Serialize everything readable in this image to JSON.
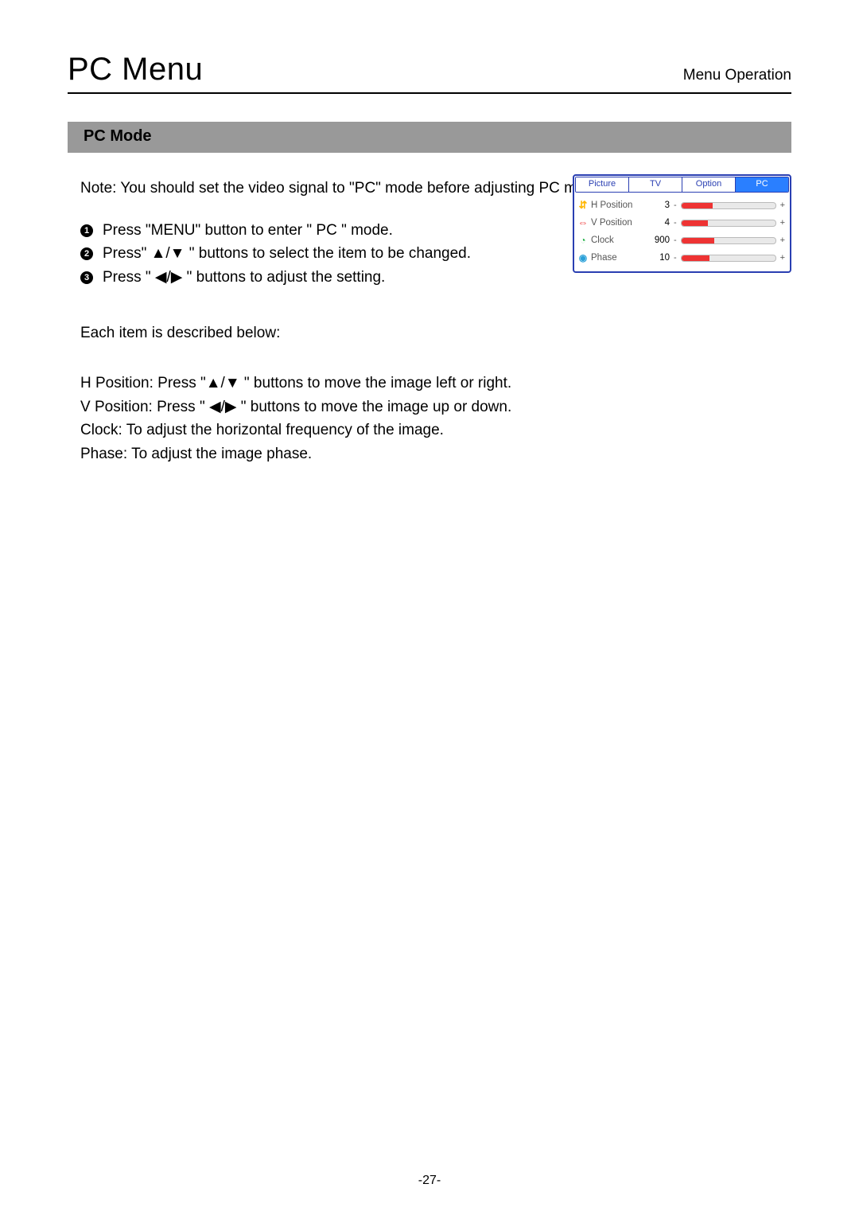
{
  "header": {
    "title": "PC Menu",
    "subtitle": "Menu Operation"
  },
  "section": {
    "title": "PC Mode"
  },
  "note": "Note: You should set the video signal to \"PC\" mode before adjusting PC mode setting.",
  "steps": {
    "s1": "Press \"MENU\" button to enter \" PC \" mode.",
    "s2": "Press\" ▲/▼ \" buttons to select the item to be changed.",
    "s3": "Press \" ◀/▶ \" buttons to adjust the setting."
  },
  "aftersteps": "Each item is described below:",
  "details": {
    "d1": "H Position: Press \"▲/▼ \" buttons to move the image left or right.",
    "d2": "V Position: Press \" ◀/▶ \" buttons to move the image up or down.",
    "d3": "Clock: To adjust the horizontal frequency of the image.",
    "d4": "Phase: To adjust the image phase."
  },
  "osd": {
    "tabs": {
      "t0": "Picture",
      "t1": "TV",
      "t2": "Option",
      "t3": "PC"
    },
    "rows": {
      "r0": {
        "label": "H Position",
        "value": "3",
        "fillpct": "33%"
      },
      "r1": {
        "label": "V Position",
        "value": "4",
        "fillpct": "28%"
      },
      "r2": {
        "label": "Clock",
        "value": "900",
        "fillpct": "35%"
      },
      "r3": {
        "label": "Phase",
        "value": "10",
        "fillpct": "30%"
      }
    },
    "minus": "-",
    "plus": "+"
  },
  "pagenum": "-27-"
}
